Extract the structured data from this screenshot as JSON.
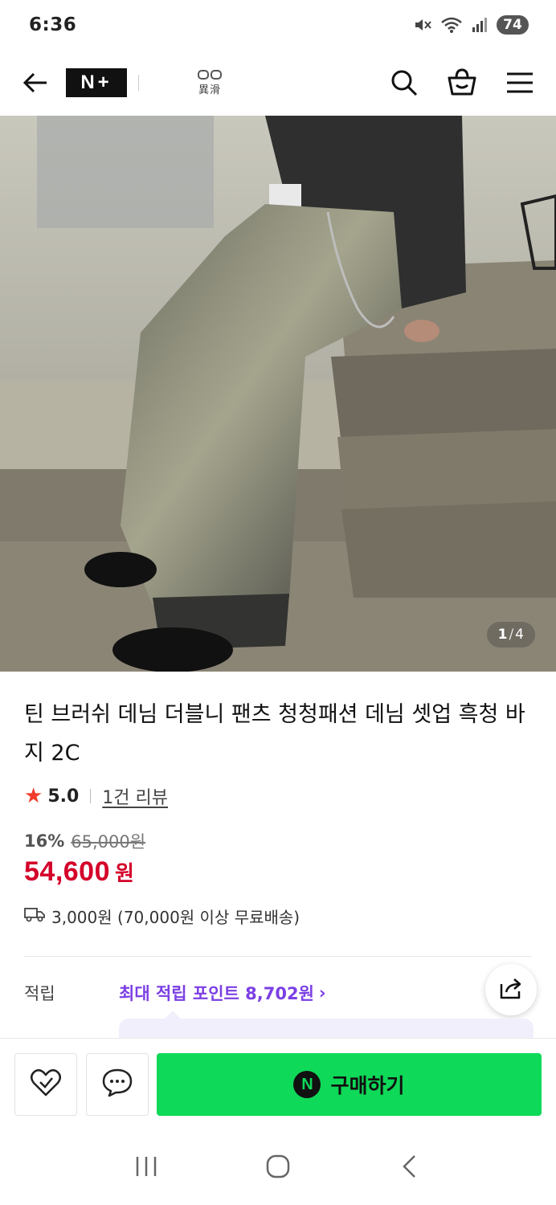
{
  "status_bar": {
    "time": "6:36",
    "battery": "74",
    "icons": [
      "mute-icon",
      "wifi-icon",
      "signal-icon"
    ]
  },
  "header": {
    "logo_text": "N+",
    "brand_sub": "異滑",
    "icons": [
      "back-arrow-icon",
      "search-icon",
      "shopping-bag-icon",
      "menu-icon"
    ]
  },
  "gallery": {
    "current": "1",
    "separator": "/",
    "total": "4"
  },
  "product": {
    "title": "틴 브러쉬 데님 더블니 팬츠 청청패션 데님 셋업 흑청 바지 2C",
    "rating": "5.0",
    "review_link": "1건 리뷰",
    "discount_pct": "16%",
    "original_price": "65,000원",
    "sale_price": "54,600",
    "sale_unit": "원",
    "shipping": "3,000원 (70,000원 이상 무료배송)"
  },
  "points": {
    "label": "적립",
    "value": "최대 적립 포인트 8,702원",
    "chevron": "›"
  },
  "bottom_bar": {
    "buy_icon_letter": "N",
    "buy_label": "구매하기"
  },
  "colors": {
    "sale_red": "#d4002a",
    "points_purple": "#7b3fe4",
    "buy_green": "#0fd958",
    "star_red": "#f03c2c"
  }
}
